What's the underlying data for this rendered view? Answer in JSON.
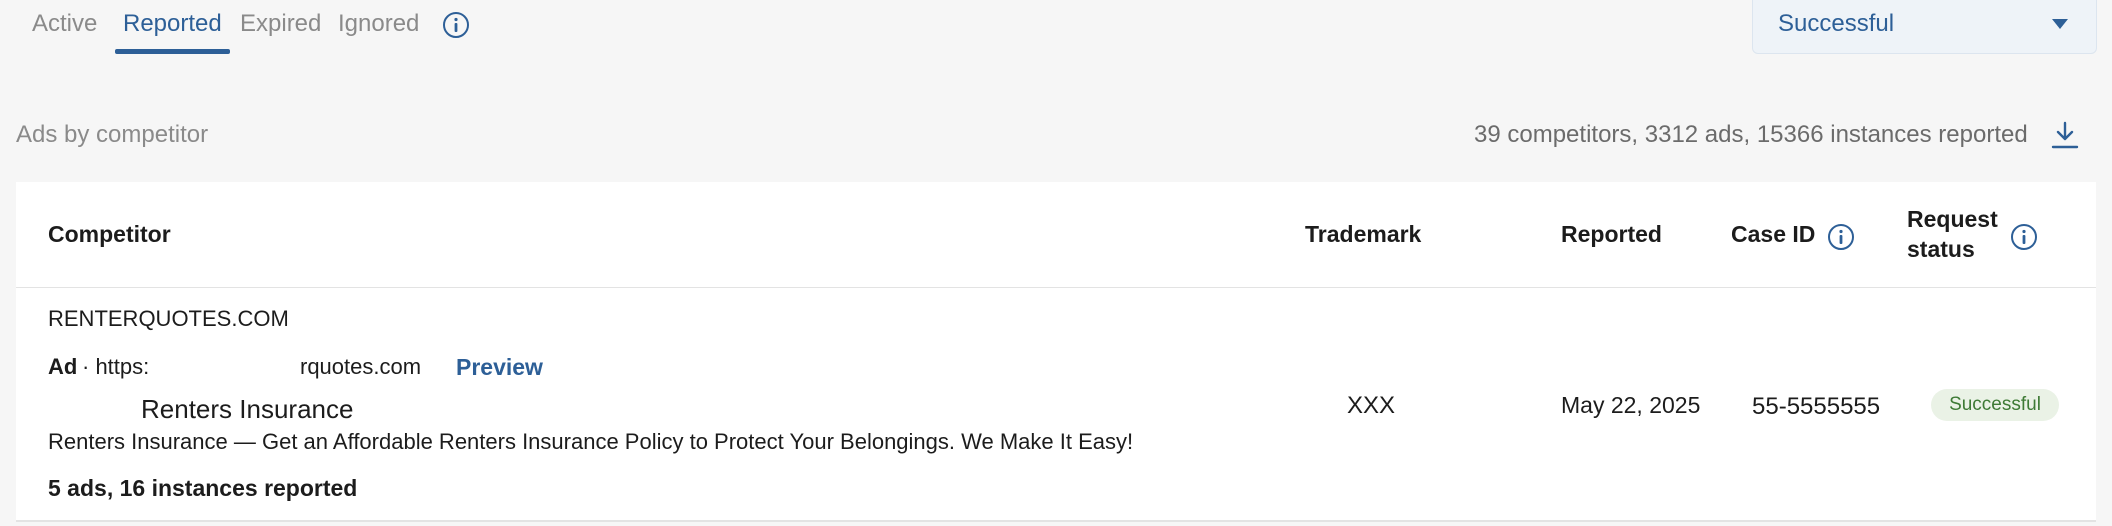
{
  "tabs": [
    {
      "label": "Active"
    },
    {
      "label": "Reported"
    },
    {
      "label": "Expired"
    },
    {
      "label": "Ignored"
    }
  ],
  "status_filter": {
    "value": "Successful"
  },
  "section_title": "Ads by competitor",
  "summary": "39 competitors, 3312 ads, 15366 instances reported",
  "table": {
    "headers": {
      "competitor": "Competitor",
      "trademark": "Trademark",
      "reported": "Reported",
      "case_id": "Case ID",
      "request_status_line1": "Request",
      "request_status_line2": "status"
    },
    "rows": [
      {
        "competitor": "RENTERQUOTES.COM",
        "ad_label": "Ad",
        "ad_url_start": "· https:",
        "ad_url_end": "rquotes.com",
        "preview": "Preview",
        "ad_title": "Renters Insurance",
        "ad_description": "Renters Insurance — Get an Affordable Renters Insurance Policy to Protect Your Belongings. We Make It Easy!",
        "counts": "5 ads, 16 instances reported",
        "trademark": "XXX",
        "reported": "May 22, 2025",
        "case_id": "55-5555555",
        "request_status": "Successful"
      }
    ]
  },
  "colors": {
    "accent": "#2d5f97",
    "success_text": "#3e7a35",
    "success_bg": "#eaf2e6",
    "muted": "#8a8a8a"
  },
  "icons": {
    "tabs_info": "info-icon",
    "download": "download-icon",
    "case_id_info": "info-icon",
    "request_status_info": "info-icon",
    "dropdown": "chevron-down-icon"
  }
}
